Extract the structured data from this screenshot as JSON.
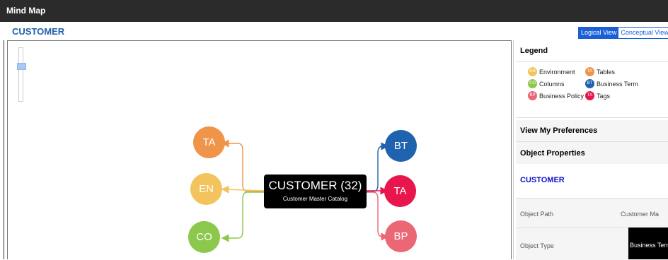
{
  "window": {
    "title": "Mind Map"
  },
  "header": {
    "entity_title": "CUSTOMER"
  },
  "view_toggle": {
    "logical": "Logical View",
    "conceptual": "Conceptual View"
  },
  "mindmap": {
    "center": {
      "title": "CUSTOMER  (32)",
      "subtitle": "Customer Master Catalog"
    },
    "left_nodes": [
      {
        "label": "TA",
        "color": "#f0944a"
      },
      {
        "label": "EN",
        "color": "#f3c45e"
      },
      {
        "label": "CO",
        "color": "#8cc84b"
      }
    ],
    "right_nodes": [
      {
        "label": "BT",
        "color": "#1f62ad"
      },
      {
        "label": "TA",
        "color": "#e8164d"
      },
      {
        "label": "BP",
        "color": "#ec6775"
      }
    ]
  },
  "legend": {
    "title": "Legend",
    "items": [
      {
        "abbr": "EN",
        "label": "Environment",
        "color": "#f3c45e"
      },
      {
        "abbr": "TA",
        "label": "Tables",
        "color": "#f0944a"
      },
      {
        "abbr": "CO",
        "label": "Columns",
        "color": "#8cc84b"
      },
      {
        "abbr": "BT",
        "label": "Business Term",
        "color": "#1f62ad"
      },
      {
        "abbr": "BP",
        "label": "Business Policy",
        "color": "#ec6775"
      },
      {
        "abbr": "TA",
        "label": "Tags",
        "color": "#e8164d"
      }
    ]
  },
  "preferences": {
    "title": "View My Preferences"
  },
  "object_properties": {
    "title": "Object Properties",
    "name": "CUSTOMER",
    "rows": [
      {
        "key": "Object Path",
        "value": "Customer Ma"
      },
      {
        "key": "Object Type",
        "value": "Business Term"
      }
    ]
  }
}
